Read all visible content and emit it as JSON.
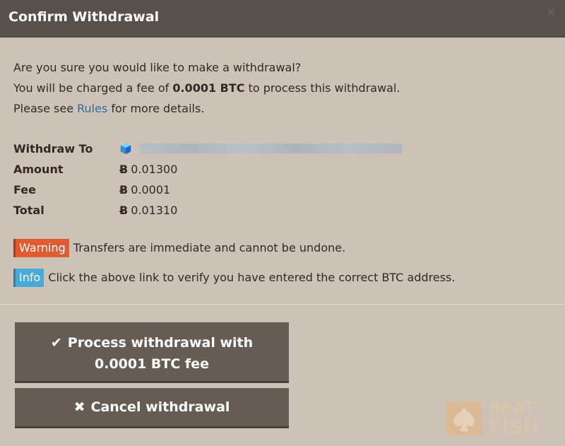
{
  "dialog": {
    "title": "Confirm Withdrawal",
    "close_icon": "close-icon",
    "close_glyph": "×"
  },
  "intro": {
    "line1": "Are you sure you would like to make a withdrawal?",
    "line2_prefix": "You will be charged a fee of ",
    "line2_fee": "0.0001 BTC",
    "line2_suffix": " to process this withdrawal.",
    "line3_prefix": "Please see ",
    "line3_link": "Rules",
    "line3_suffix": " for more details."
  },
  "details": {
    "withdraw_to_label": "Withdraw To",
    "withdraw_to_icon": "blue-cube-icon",
    "amount_label": "Amount",
    "amount_value": "0.01300",
    "fee_label": "Fee",
    "fee_value": "0.0001",
    "total_label": "Total",
    "total_value": "0.01310",
    "currency_symbol": "Ƀ"
  },
  "alerts": {
    "warning_tag": "Warning",
    "warning_text": "Transfers are immediate and cannot be undone.",
    "info_tag": "Info",
    "info_text": "Click the above link to verify you have entered the correct BTC address."
  },
  "buttons": {
    "process_line1": "Process withdrawal with",
    "process_line2": "0.0001 BTC fee",
    "process_icon": "checkmark-icon",
    "process_glyph": "✔",
    "cancel_label": "Cancel withdrawal",
    "cancel_icon": "x-icon",
    "cancel_glyph": "✖"
  },
  "watermark": {
    "beat": "BEAT",
    "the": "THE",
    "fish": "FISH"
  },
  "colors": {
    "header_bg": "#57504b",
    "body_bg": "#cdc2b5",
    "button_bg": "#675c53",
    "link": "#2b6ea8",
    "warning": "#e05a32",
    "info": "#4aaad6"
  }
}
